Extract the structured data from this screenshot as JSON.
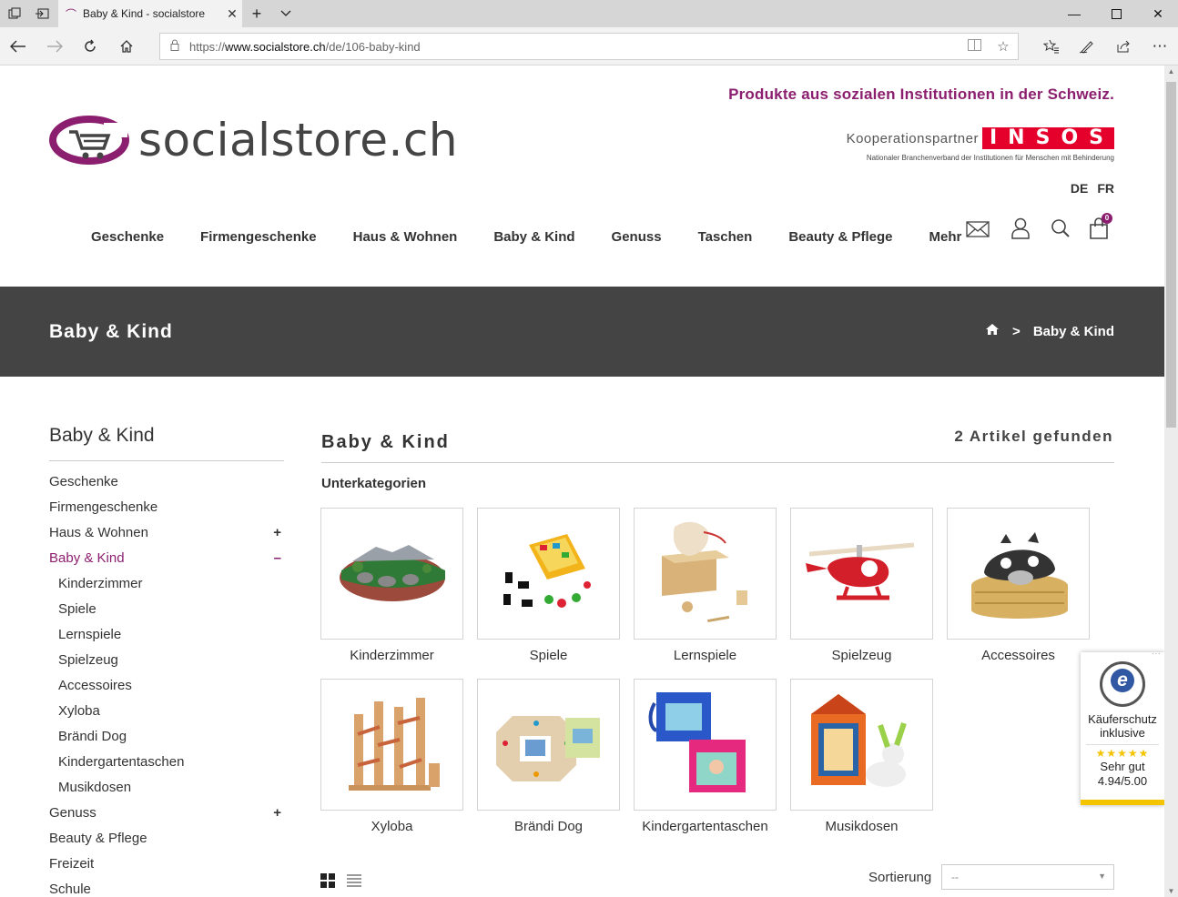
{
  "browser": {
    "tab_title": "Baby & Kind - socialstore",
    "url_prefix": "https://",
    "url_domain": "www.socialstore.ch",
    "url_path": "/de/106-baby-kind"
  },
  "header": {
    "tagline": "Produkte aus sozialen Institutionen in der Schweiz.",
    "logo_text": "socialstore.ch",
    "partner_label": "Kooperationspartner",
    "partner_name": "INSOS",
    "partner_sub": "Nationaler Branchenverband der Institutionen für Menschen mit Behinderung",
    "lang_de": "DE",
    "lang_fr": "FR",
    "cart_count": "0"
  },
  "nav": {
    "items": [
      "Geschenke",
      "Firmengeschenke",
      "Haus & Wohnen",
      "Baby & Kind",
      "Genuss",
      "Taschen",
      "Beauty & Pflege",
      "Mehr"
    ]
  },
  "banner": {
    "title": "Baby & Kind",
    "crumb_sep": ">",
    "crumb_current": "Baby & Kind"
  },
  "sidebar": {
    "title": "Baby & Kind",
    "items": [
      {
        "label": "Geschenke",
        "toggle": ""
      },
      {
        "label": "Firmengeschenke",
        "toggle": ""
      },
      {
        "label": "Haus & Wohnen",
        "toggle": "+"
      },
      {
        "label": "Baby & Kind",
        "toggle": "–"
      },
      {
        "label": "Kinderzimmer",
        "toggle": ""
      },
      {
        "label": "Spiele",
        "toggle": ""
      },
      {
        "label": "Lernspiele",
        "toggle": ""
      },
      {
        "label": "Spielzeug",
        "toggle": ""
      },
      {
        "label": "Accessoires",
        "toggle": ""
      },
      {
        "label": "Xyloba",
        "toggle": ""
      },
      {
        "label": "Brändi Dog",
        "toggle": ""
      },
      {
        "label": "Kindergartentaschen",
        "toggle": ""
      },
      {
        "label": "Musikdosen",
        "toggle": ""
      },
      {
        "label": "Genuss",
        "toggle": "+"
      },
      {
        "label": "Beauty & Pflege",
        "toggle": ""
      },
      {
        "label": "Freizeit",
        "toggle": ""
      },
      {
        "label": "Schule",
        "toggle": ""
      }
    ]
  },
  "content": {
    "title": "Baby & Kind",
    "count": "2 Artikel gefunden",
    "subcategories_heading": "Unterkategorien",
    "categories": [
      "Kinderzimmer",
      "Spiele",
      "Lernspiele",
      "Spielzeug",
      "Accessoires",
      "Xyloba",
      "Brändi Dog",
      "Kindergartentaschen",
      "Musikdosen"
    ],
    "sort_label": "Sortierung",
    "sort_value": "--"
  },
  "trust": {
    "line1": "Käuferschutz",
    "line2": "inklusive",
    "stars": "★★★★★",
    "rating_text": "Sehr gut",
    "rating_value": "4.94/5.00"
  }
}
